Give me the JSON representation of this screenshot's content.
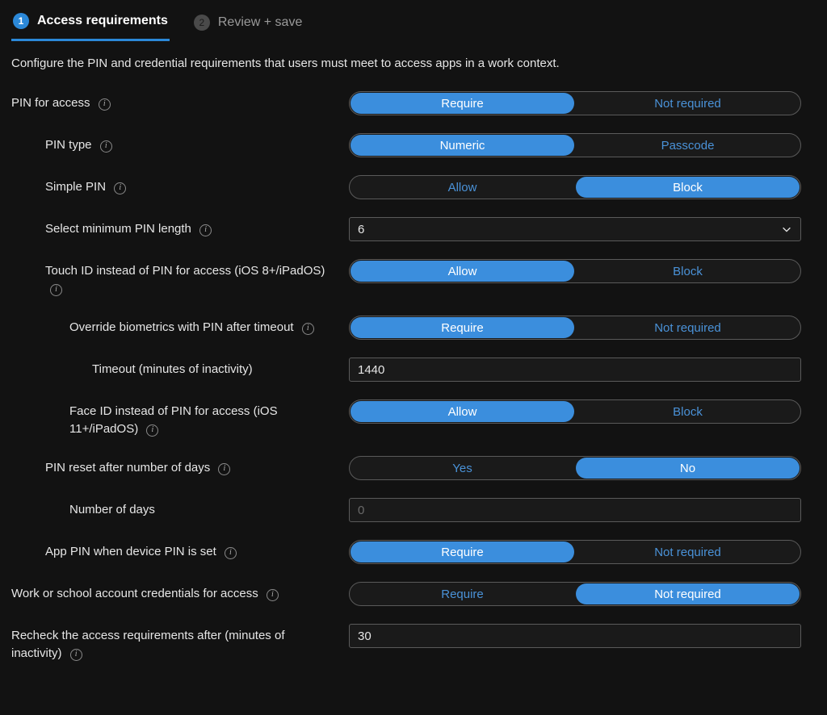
{
  "tabs": {
    "step1_num": "1",
    "step1_label": "Access requirements",
    "step2_num": "2",
    "step2_label": "Review + save"
  },
  "description": "Configure the PIN and credential requirements that users must meet to access apps in a work context.",
  "rows": {
    "pin_for_access": {
      "label": "PIN for access",
      "opt1": "Require",
      "opt2": "Not required"
    },
    "pin_type": {
      "label": "PIN type",
      "opt1": "Numeric",
      "opt2": "Passcode"
    },
    "simple_pin": {
      "label": "Simple PIN",
      "opt1": "Allow",
      "opt2": "Block"
    },
    "min_pin_length": {
      "label": "Select minimum PIN length",
      "value": "6"
    },
    "touch_id": {
      "label": "Touch ID instead of PIN for access (iOS 8+/iPadOS)",
      "opt1": "Allow",
      "opt2": "Block"
    },
    "override_bio": {
      "label": "Override biometrics with PIN after timeout",
      "opt1": "Require",
      "opt2": "Not required"
    },
    "timeout": {
      "label": "Timeout (minutes of inactivity)",
      "value": "1440"
    },
    "face_id": {
      "label": "Face ID instead of PIN for access (iOS 11+/iPadOS)",
      "opt1": "Allow",
      "opt2": "Block"
    },
    "pin_reset": {
      "label": "PIN reset after number of days",
      "opt1": "Yes",
      "opt2": "No"
    },
    "num_days": {
      "label": "Number of days",
      "value": "0"
    },
    "app_pin": {
      "label": "App PIN when device PIN is set",
      "opt1": "Require",
      "opt2": "Not required"
    },
    "work_creds": {
      "label": "Work or school account credentials for access",
      "opt1": "Require",
      "opt2": "Not required"
    },
    "recheck": {
      "label": "Recheck the access requirements after (minutes of inactivity)",
      "value": "30"
    }
  }
}
